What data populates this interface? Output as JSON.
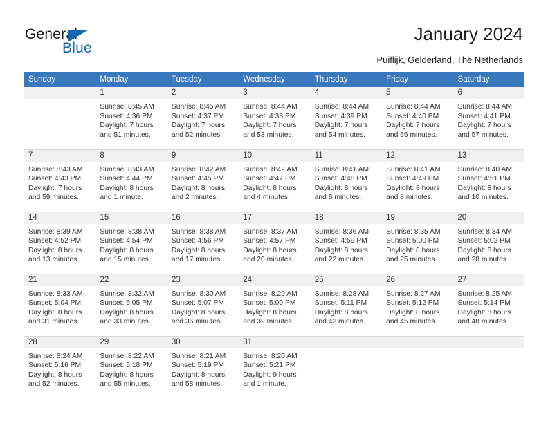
{
  "logo": {
    "word_top": "General",
    "word_bottom": "Blue",
    "accent_color": "#1268b3"
  },
  "header": {
    "title": "January 2024",
    "subtitle": "Puiflijk, Gelderland, The Netherlands",
    "header_bg_color": "#3a78bd",
    "daynum_bg_color": "#f0f0f0"
  },
  "weekday_headers": [
    "Sunday",
    "Monday",
    "Tuesday",
    "Wednesday",
    "Thursday",
    "Friday",
    "Saturday"
  ],
  "labels": {
    "sunrise_prefix": "Sunrise:",
    "sunset_prefix": "Sunset:",
    "daylight_prefix": "Daylight:"
  },
  "weeks": [
    [
      {
        "day": "",
        "blank": true,
        "sunrise": "",
        "sunset": "",
        "daylight_line1": "",
        "daylight_line2": ""
      },
      {
        "day": "1",
        "blank": false,
        "sunrise": "Sunrise: 8:45 AM",
        "sunset": "Sunset: 4:36 PM",
        "daylight_line1": "Daylight: 7 hours",
        "daylight_line2": "and 51 minutes."
      },
      {
        "day": "2",
        "blank": false,
        "sunrise": "Sunrise: 8:45 AM",
        "sunset": "Sunset: 4:37 PM",
        "daylight_line1": "Daylight: 7 hours",
        "daylight_line2": "and 52 minutes."
      },
      {
        "day": "3",
        "blank": false,
        "sunrise": "Sunrise: 8:44 AM",
        "sunset": "Sunset: 4:38 PM",
        "daylight_line1": "Daylight: 7 hours",
        "daylight_line2": "and 53 minutes."
      },
      {
        "day": "4",
        "blank": false,
        "sunrise": "Sunrise: 8:44 AM",
        "sunset": "Sunset: 4:39 PM",
        "daylight_line1": "Daylight: 7 hours",
        "daylight_line2": "and 54 minutes."
      },
      {
        "day": "5",
        "blank": false,
        "sunrise": "Sunrise: 8:44 AM",
        "sunset": "Sunset: 4:40 PM",
        "daylight_line1": "Daylight: 7 hours",
        "daylight_line2": "and 56 minutes."
      },
      {
        "day": "6",
        "blank": false,
        "sunrise": "Sunrise: 8:44 AM",
        "sunset": "Sunset: 4:41 PM",
        "daylight_line1": "Daylight: 7 hours",
        "daylight_line2": "and 57 minutes."
      }
    ],
    [
      {
        "day": "7",
        "blank": false,
        "sunrise": "Sunrise: 8:43 AM",
        "sunset": "Sunset: 4:43 PM",
        "daylight_line1": "Daylight: 7 hours",
        "daylight_line2": "and 59 minutes."
      },
      {
        "day": "8",
        "blank": false,
        "sunrise": "Sunrise: 8:43 AM",
        "sunset": "Sunset: 4:44 PM",
        "daylight_line1": "Daylight: 8 hours",
        "daylight_line2": "and 1 minute."
      },
      {
        "day": "9",
        "blank": false,
        "sunrise": "Sunrise: 8:42 AM",
        "sunset": "Sunset: 4:45 PM",
        "daylight_line1": "Daylight: 8 hours",
        "daylight_line2": "and 2 minutes."
      },
      {
        "day": "10",
        "blank": false,
        "sunrise": "Sunrise: 8:42 AM",
        "sunset": "Sunset: 4:47 PM",
        "daylight_line1": "Daylight: 8 hours",
        "daylight_line2": "and 4 minutes."
      },
      {
        "day": "11",
        "blank": false,
        "sunrise": "Sunrise: 8:41 AM",
        "sunset": "Sunset: 4:48 PM",
        "daylight_line1": "Daylight: 8 hours",
        "daylight_line2": "and 6 minutes."
      },
      {
        "day": "12",
        "blank": false,
        "sunrise": "Sunrise: 8:41 AM",
        "sunset": "Sunset: 4:49 PM",
        "daylight_line1": "Daylight: 8 hours",
        "daylight_line2": "and 8 minutes."
      },
      {
        "day": "13",
        "blank": false,
        "sunrise": "Sunrise: 8:40 AM",
        "sunset": "Sunset: 4:51 PM",
        "daylight_line1": "Daylight: 8 hours",
        "daylight_line2": "and 10 minutes."
      }
    ],
    [
      {
        "day": "14",
        "blank": false,
        "sunrise": "Sunrise: 8:39 AM",
        "sunset": "Sunset: 4:52 PM",
        "daylight_line1": "Daylight: 8 hours",
        "daylight_line2": "and 13 minutes."
      },
      {
        "day": "15",
        "blank": false,
        "sunrise": "Sunrise: 8:38 AM",
        "sunset": "Sunset: 4:54 PM",
        "daylight_line1": "Daylight: 8 hours",
        "daylight_line2": "and 15 minutes."
      },
      {
        "day": "16",
        "blank": false,
        "sunrise": "Sunrise: 8:38 AM",
        "sunset": "Sunset: 4:56 PM",
        "daylight_line1": "Daylight: 8 hours",
        "daylight_line2": "and 17 minutes."
      },
      {
        "day": "17",
        "blank": false,
        "sunrise": "Sunrise: 8:37 AM",
        "sunset": "Sunset: 4:57 PM",
        "daylight_line1": "Daylight: 8 hours",
        "daylight_line2": "and 20 minutes."
      },
      {
        "day": "18",
        "blank": false,
        "sunrise": "Sunrise: 8:36 AM",
        "sunset": "Sunset: 4:59 PM",
        "daylight_line1": "Daylight: 8 hours",
        "daylight_line2": "and 22 minutes."
      },
      {
        "day": "19",
        "blank": false,
        "sunrise": "Sunrise: 8:35 AM",
        "sunset": "Sunset: 5:00 PM",
        "daylight_line1": "Daylight: 8 hours",
        "daylight_line2": "and 25 minutes."
      },
      {
        "day": "20",
        "blank": false,
        "sunrise": "Sunrise: 8:34 AM",
        "sunset": "Sunset: 5:02 PM",
        "daylight_line1": "Daylight: 8 hours",
        "daylight_line2": "and 28 minutes."
      }
    ],
    [
      {
        "day": "21",
        "blank": false,
        "sunrise": "Sunrise: 8:33 AM",
        "sunset": "Sunset: 5:04 PM",
        "daylight_line1": "Daylight: 8 hours",
        "daylight_line2": "and 31 minutes."
      },
      {
        "day": "22",
        "blank": false,
        "sunrise": "Sunrise: 8:32 AM",
        "sunset": "Sunset: 5:05 PM",
        "daylight_line1": "Daylight: 8 hours",
        "daylight_line2": "and 33 minutes."
      },
      {
        "day": "23",
        "blank": false,
        "sunrise": "Sunrise: 8:30 AM",
        "sunset": "Sunset: 5:07 PM",
        "daylight_line1": "Daylight: 8 hours",
        "daylight_line2": "and 36 minutes."
      },
      {
        "day": "24",
        "blank": false,
        "sunrise": "Sunrise: 8:29 AM",
        "sunset": "Sunset: 5:09 PM",
        "daylight_line1": "Daylight: 8 hours",
        "daylight_line2": "and 39 minutes."
      },
      {
        "day": "25",
        "blank": false,
        "sunrise": "Sunrise: 8:28 AM",
        "sunset": "Sunset: 5:11 PM",
        "daylight_line1": "Daylight: 8 hours",
        "daylight_line2": "and 42 minutes."
      },
      {
        "day": "26",
        "blank": false,
        "sunrise": "Sunrise: 8:27 AM",
        "sunset": "Sunset: 5:12 PM",
        "daylight_line1": "Daylight: 8 hours",
        "daylight_line2": "and 45 minutes."
      },
      {
        "day": "27",
        "blank": false,
        "sunrise": "Sunrise: 8:25 AM",
        "sunset": "Sunset: 5:14 PM",
        "daylight_line1": "Daylight: 8 hours",
        "daylight_line2": "and 48 minutes."
      }
    ],
    [
      {
        "day": "28",
        "blank": false,
        "sunrise": "Sunrise: 8:24 AM",
        "sunset": "Sunset: 5:16 PM",
        "daylight_line1": "Daylight: 8 hours",
        "daylight_line2": "and 52 minutes."
      },
      {
        "day": "29",
        "blank": false,
        "sunrise": "Sunrise: 8:22 AM",
        "sunset": "Sunset: 5:18 PM",
        "daylight_line1": "Daylight: 8 hours",
        "daylight_line2": "and 55 minutes."
      },
      {
        "day": "30",
        "blank": false,
        "sunrise": "Sunrise: 8:21 AM",
        "sunset": "Sunset: 5:19 PM",
        "daylight_line1": "Daylight: 8 hours",
        "daylight_line2": "and 58 minutes."
      },
      {
        "day": "31",
        "blank": false,
        "sunrise": "Sunrise: 8:20 AM",
        "sunset": "Sunset: 5:21 PM",
        "daylight_line1": "Daylight: 9 hours",
        "daylight_line2": "and 1 minute."
      },
      {
        "day": "",
        "blank": true,
        "sunrise": "",
        "sunset": "",
        "daylight_line1": "",
        "daylight_line2": ""
      },
      {
        "day": "",
        "blank": true,
        "sunrise": "",
        "sunset": "",
        "daylight_line1": "",
        "daylight_line2": ""
      },
      {
        "day": "",
        "blank": true,
        "sunrise": "",
        "sunset": "",
        "daylight_line1": "",
        "daylight_line2": ""
      }
    ]
  ]
}
